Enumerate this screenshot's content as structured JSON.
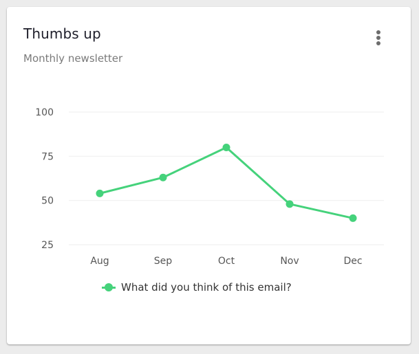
{
  "card": {
    "title": "Thumbs up",
    "subtitle": "Monthly newsletter",
    "menu_icon": "more-vertical-icon"
  },
  "colors": {
    "series": "#45d27b",
    "grid": "#f0f0f0",
    "tick_text": "#555555"
  },
  "chart_data": {
    "type": "line",
    "title": "Thumbs up",
    "subtitle": "Monthly newsletter",
    "categories": [
      "Aug",
      "Sep",
      "Oct",
      "Nov",
      "Dec"
    ],
    "series": [
      {
        "name": "What did you think of this email?",
        "values": [
          54,
          63,
          80,
          48,
          40
        ]
      }
    ],
    "xlabel": "",
    "ylabel": "",
    "ylim": [
      25,
      100
    ],
    "yticks": [
      100,
      75,
      50,
      25
    ],
    "grid": true,
    "legend": "bottom-center"
  }
}
